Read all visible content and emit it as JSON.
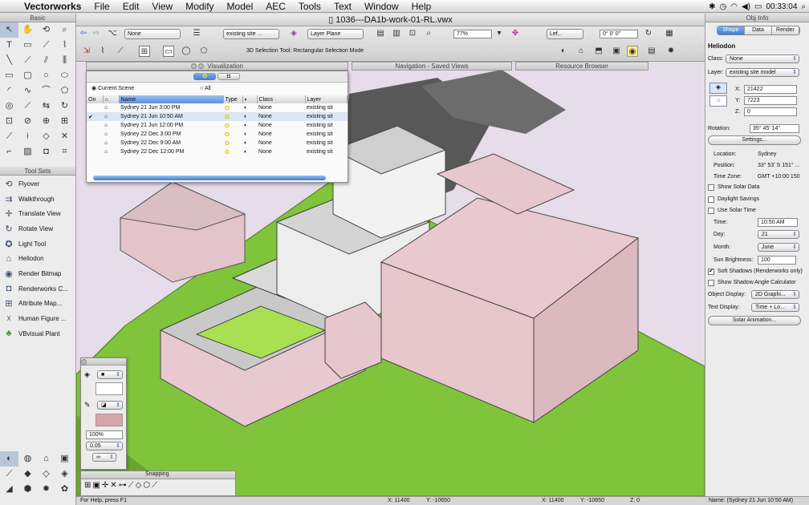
{
  "menubar": {
    "app": "Vectorworks",
    "items": [
      "File",
      "Edit",
      "View",
      "Modify",
      "Model",
      "AEC",
      "Tools",
      "Text",
      "Window",
      "Help"
    ],
    "clock": "00:33:04"
  },
  "document": {
    "title": "1036---DA1b-work-01-RL.vwx"
  },
  "toolbar": {
    "class_popup": "None",
    "layer_popup": "existing site ...",
    "plane_popup": "Layer Plane",
    "zoom": "77%",
    "view_popup": "Lef...",
    "angle": "0° 0' 0\"",
    "mode_message": "3D Selection Tool: Rectangular Selection Mode"
  },
  "palettes": {
    "visualization": "Visualization",
    "navigation": "Navigation - Saved Views",
    "resource": "Resource Browser",
    "tool_sets": "Tool Sets",
    "basic": "Basic",
    "snapping": "Snapping"
  },
  "visualization": {
    "radio_current": "Current Scene",
    "radio_all": "All",
    "columns": [
      "On",
      "",
      "Name",
      "Type",
      "",
      "Class",
      "Layer"
    ],
    "rows": [
      {
        "on": "",
        "name": "Sydney 21 Jun 3:00 PM",
        "class": "None",
        "layer": "existing sit"
      },
      {
        "on": "✔",
        "name": "Sydney 21 Jun 10:50 AM",
        "class": "None",
        "layer": "existing sit"
      },
      {
        "on": "",
        "name": "Sydney 21 Jun 12:00 PM",
        "class": "None",
        "layer": "existing sit"
      },
      {
        "on": "",
        "name": "Sydney 22 Dec 3:00 PM",
        "class": "None",
        "layer": "existing sit"
      },
      {
        "on": "",
        "name": "Sydney 22 Dec 9:00 AM",
        "class": "None",
        "layer": "existing sit"
      },
      {
        "on": "",
        "name": "Sydney 22 Dec 12:00 PM",
        "class": "None",
        "layer": "existing sit"
      }
    ]
  },
  "toolsets": {
    "items": [
      "Flyover",
      "Walkthrough",
      "Translate View",
      "Rotate View",
      "Light Tool",
      "Heliodon",
      "Render Bitmap",
      "Renderworks C...",
      "Attribute Map...",
      "Human Figure ...",
      "VBvisual Plant"
    ]
  },
  "attributes": {
    "opacity": "100%",
    "line_weight": "0.05"
  },
  "obj_info": {
    "title": "Obj Info",
    "tabs": [
      "Shape",
      "Data",
      "Render"
    ],
    "object_name": "Heliodon",
    "class_label": "Class:",
    "class_value": "None",
    "layer_label": "Layer:",
    "layer_value": "existing site model",
    "x_label": "X:",
    "x_value": "21422",
    "y_label": "Y:",
    "y_value": "7223",
    "z_label": "Z:",
    "z_value": "0",
    "rotation_label": "Rotation:",
    "rotation_value": "35° 45' 14\"",
    "settings_button": "Settings...",
    "location_label": "Location:",
    "location_value": "Sydney",
    "position_label": "Position:",
    "position_value": "33° 53' S  151° ...",
    "timezone_label": "Time Zone:",
    "timezone_value": "GMT +10:00 150",
    "show_solar": "Show Solar Data",
    "daylight": "Daylight Savings",
    "use_solar": "Use Solar Time",
    "time_label": "Time:",
    "time_value": "10:50 AM",
    "day_label": "Day:",
    "day_value": "21",
    "month_label": "Month:",
    "month_value": "June",
    "brightness_label": "Sun Brightness:",
    "brightness_value": "100",
    "soft_shadows": "Soft Shadows (Renderworks only)",
    "shadow_angle": "Show Shadow Angle Calculator",
    "object_display_label": "Object Display:",
    "object_display_value": "2D Graphi...",
    "text_display_label": "Text Display:",
    "text_display_value": "Time + Lo...",
    "solar_button": "Solar Animation...",
    "status_name": "Name: (Sydney 21 Jun 10:50 AM)"
  },
  "status": {
    "help": "For Help, press F1",
    "x1": "X: 11400",
    "y1": "Y: -10650",
    "x2": "X: 11400",
    "y2": "Y: -10650",
    "z": "Z: 0"
  },
  "colors": {
    "ground": "#7fc43a",
    "walls": "#e8c9cf",
    "roof": "#d6d6d6",
    "sky": "#e7dce9"
  }
}
